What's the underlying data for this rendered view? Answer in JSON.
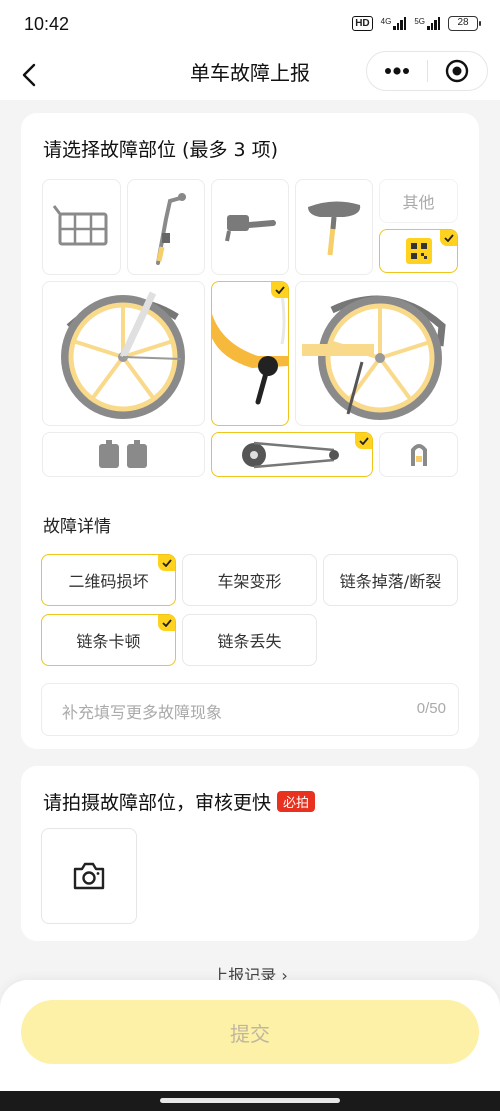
{
  "status_bar": {
    "time": "10:42",
    "hd": "HD",
    "net1": "4G",
    "net2": "5G",
    "battery": "28"
  },
  "nav": {
    "title": "单车故障上报"
  },
  "parts_section": {
    "title": "请选择故障部位 (最多 3 项)",
    "other_label": "其他",
    "parts": [
      {
        "id": "basket",
        "selected": false
      },
      {
        "id": "handlebar-left",
        "selected": false
      },
      {
        "id": "brake-lever",
        "selected": false
      },
      {
        "id": "saddle",
        "selected": false
      },
      {
        "id": "qr-code",
        "selected": true
      },
      {
        "id": "front-wheel",
        "selected": false
      },
      {
        "id": "frame-crank",
        "selected": true
      },
      {
        "id": "rear-wheel",
        "selected": false
      },
      {
        "id": "pedals",
        "selected": false
      },
      {
        "id": "chain",
        "selected": true
      },
      {
        "id": "lock",
        "selected": false
      }
    ]
  },
  "details_section": {
    "title": "故障详情",
    "chips": [
      {
        "label": "二维码损坏",
        "selected": true
      },
      {
        "label": "车架变形",
        "selected": false
      },
      {
        "label": "链条掉落/断裂",
        "selected": false
      },
      {
        "label": "链条卡顿",
        "selected": true
      },
      {
        "label": "链条丢失",
        "selected": false
      }
    ],
    "textarea_placeholder": "补充填写更多故障现象",
    "textarea_count": "0/50"
  },
  "photo_section": {
    "title": "请拍摄故障部位，审核更快",
    "badge": "必拍"
  },
  "records_link": "上报记录 ›",
  "submit_label": "提交",
  "colors": {
    "accent": "#ffd21f",
    "selected_border": "#f0c419",
    "wheel": "#f9d98a",
    "badge": "#e8321f",
    "submit_bg": "#fdf1a7"
  }
}
